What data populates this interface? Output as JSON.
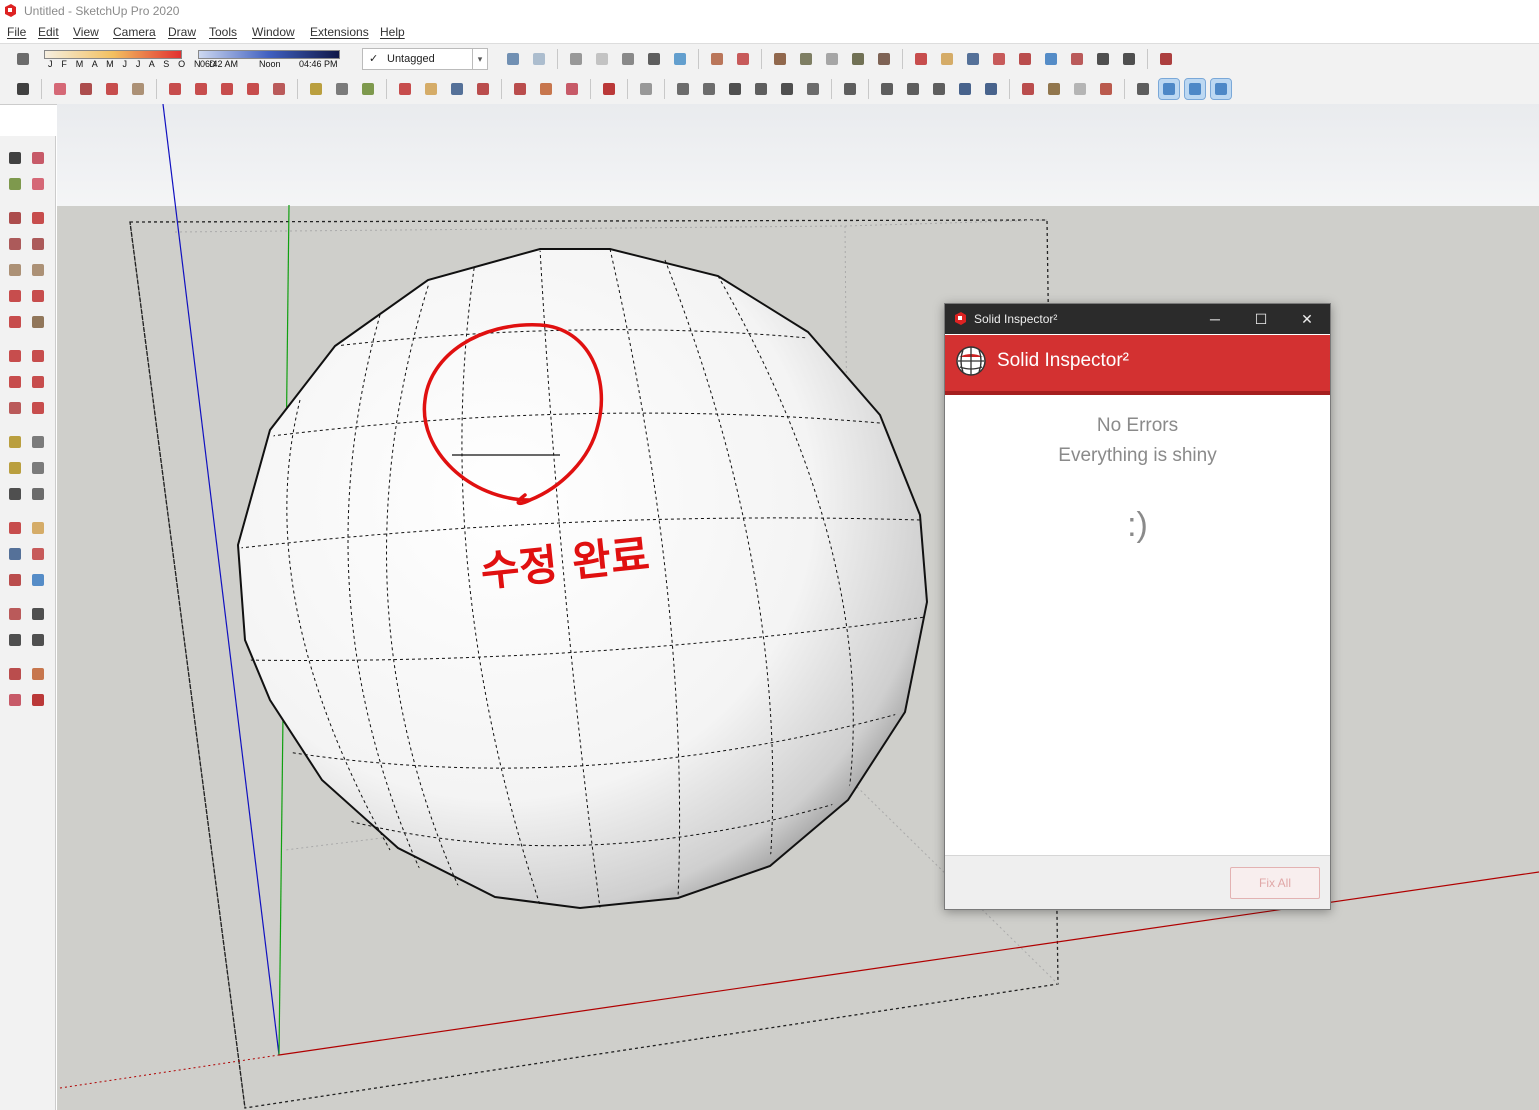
{
  "window": {
    "title": "Untitled - SketchUp Pro 2020"
  },
  "menu": [
    "File",
    "Edit",
    "View",
    "Camera",
    "Draw",
    "Tools",
    "Window",
    "Extensions",
    "Help"
  ],
  "shadow_months": "J F M A M J J A S O N D",
  "time": {
    "start": "06:42 AM",
    "noon": "Noon",
    "end": "04:46 PM"
  },
  "tag": {
    "check": "✓",
    "selected": "Untagged",
    "arrow": "▾"
  },
  "annotation": {
    "text": "수정 완료",
    "color": "#e01010"
  },
  "dialog": {
    "window_title": "Solid Inspector²",
    "header_title": "Solid Inspector²",
    "controls": {
      "minimize": "─",
      "maximize": "☐",
      "close": "✕"
    },
    "message_line1": "No Errors",
    "message_line2": "Everything is shiny",
    "smiley": ":)",
    "fix_all": "Fix All",
    "accent": "#d33131"
  },
  "colors": {
    "axis_blue": "#1010c0",
    "axis_green": "#10a010",
    "axis_red": "#b00000"
  }
}
